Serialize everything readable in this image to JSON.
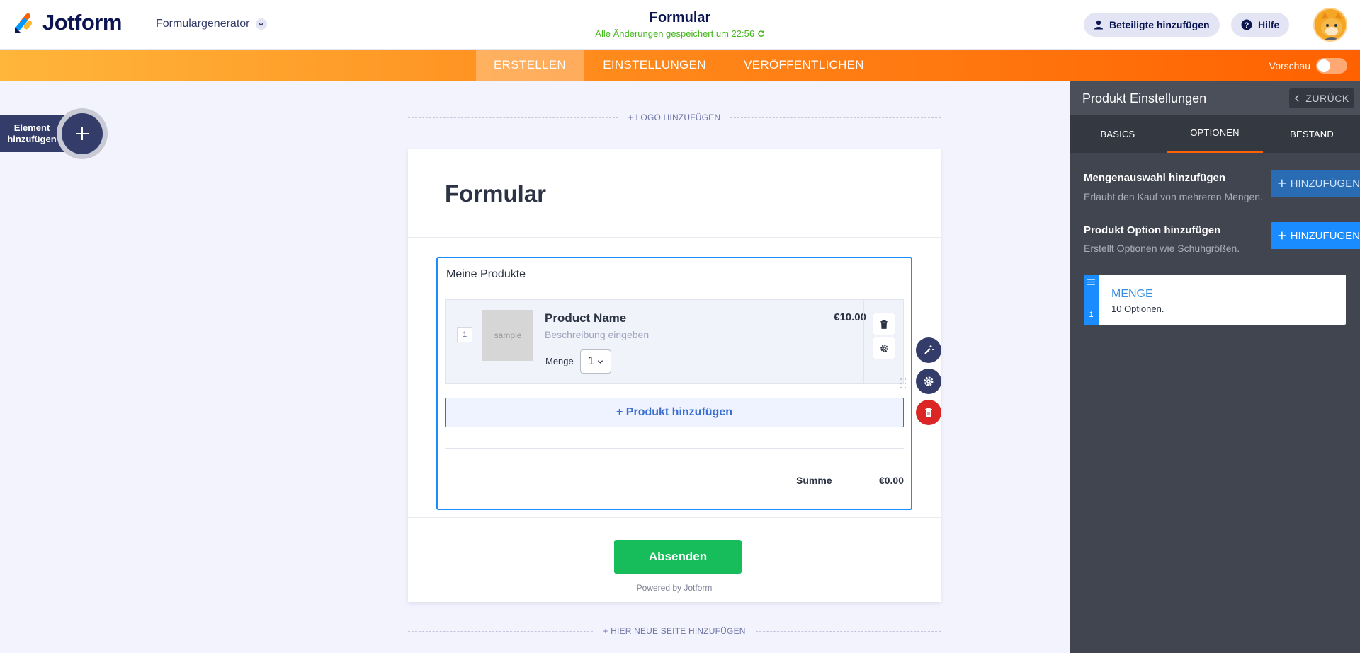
{
  "header": {
    "logo_text": "Jotform",
    "form_builder_menu": "Formulargenerator",
    "form_title": "Formular",
    "save_status": "Alle Änderungen gespeichert um 22:56",
    "add_participants": "Beteiligte hinzufügen",
    "help": "Hilfe"
  },
  "nav": {
    "tabs": [
      "ERSTELLEN",
      "EINSTELLUNGEN",
      "VERÖFFENTLICHEN"
    ],
    "active": "ERSTELLEN",
    "preview_label": "Vorschau",
    "preview_on": false
  },
  "builder": {
    "add_element_label": "Element hinzufügen",
    "add_logo": "+ LOGO HINZUFÜGEN",
    "add_page": "+ HIER NEUE SEITE HINZUFÜGEN"
  },
  "form": {
    "title": "Formular",
    "field_label": "Meine Produkte",
    "product": {
      "index": "1",
      "image_placeholder": "sample",
      "name": "Product Name",
      "description_placeholder": "Beschreibung eingeben",
      "qty_label": "Menge",
      "qty_value": "1",
      "price": "€10.00"
    },
    "add_product": "+ Produkt hinzufügen",
    "sum_label": "Summe",
    "sum_value": "€0.00",
    "submit": "Absenden",
    "powered_by": "Powered by Jotform"
  },
  "panel": {
    "title": "Produkt Einstellungen",
    "back": "ZURÜCK",
    "tabs": [
      "BASICS",
      "OPTIONEN",
      "BESTAND"
    ],
    "active_tab": "OPTIONEN",
    "quantity_option": {
      "title": "Mengenauswahl hinzufügen",
      "subtitle": "Erlaubt den Kauf von mehreren Mengen.",
      "button": "HINZUFÜGEN"
    },
    "product_option": {
      "title": "Produkt Option hinzufügen",
      "subtitle": "Erstellt Optionen wie Schuhgrößen.",
      "button": "HINZUFÜGEN"
    },
    "option_card": {
      "index": "1",
      "title": "MENGE",
      "subtitle": "10 Optionen."
    }
  },
  "colors": {
    "accent_orange": "#ff6100",
    "brand_navy": "#0a1551",
    "field_selected_blue": "#1a8cff",
    "submit_green": "#18bd5b",
    "delete_red": "#dc2626",
    "saved_green": "#44b71c",
    "panel_dark": "#41454f"
  }
}
